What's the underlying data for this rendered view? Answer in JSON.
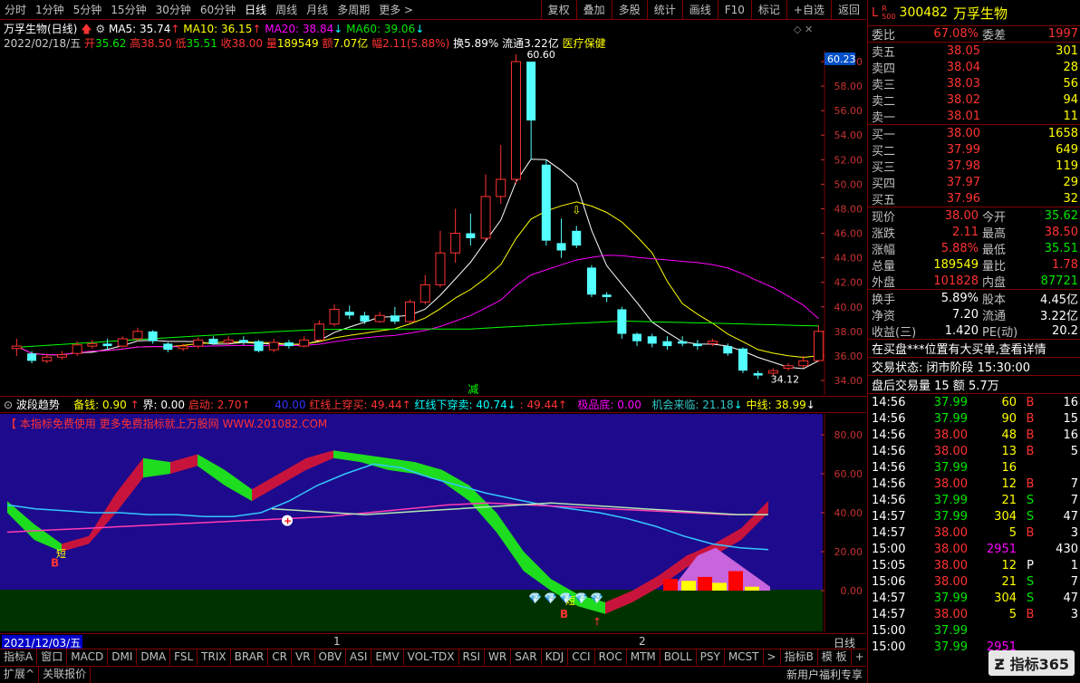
{
  "toolbar": {
    "periods": [
      "分时",
      "1分钟",
      "5分钟",
      "15分钟",
      "30分钟",
      "60分钟",
      "日线",
      "周线",
      "月线",
      "多周期",
      "更多 >"
    ],
    "active": "日线",
    "right": [
      "复权",
      "叠加",
      "多股",
      "统计",
      "画线",
      "F10",
      "标记",
      "+自选",
      "返回"
    ]
  },
  "stock": {
    "name": "万孚生物(日线)",
    "ma5": "MA5: 35.74",
    "ma10": "MA10: 36.15",
    "ma20": "MA20: 38.84",
    "ma60": "MA60: 39.06"
  },
  "kline_info": {
    "date": "2022/02/18/五",
    "open_l": "开",
    "open": "35.62",
    "high_l": "高",
    "high": "38.50",
    "low_l": "低",
    "low": "35.51",
    "close_l": "收",
    "close": "38.00",
    "vol_l": "量",
    "vol": "189549",
    "amt_l": "额",
    "amt": "7.07亿",
    "chg_l": "幅",
    "chg": "2.11(5.88%)",
    "turn": "换5.89%",
    "float": "流通3.22亿",
    "sector": "医疗保健"
  },
  "price_axis": [
    "60.00",
    "58.00",
    "56.00",
    "54.00",
    "52.00",
    "50.00",
    "48.00",
    "46.00",
    "44.00",
    "42.00",
    "40.00",
    "38.00",
    "36.00",
    "34.00"
  ],
  "price_tag": "60.23",
  "annotations": {
    "high": "60.60",
    "low": "34.12",
    "jian": "减"
  },
  "ind_header": {
    "name": "波段趋势",
    "a": "备钱: 0.90",
    "b": "界: 0.00",
    "c": "启动: 2.70",
    "d": "40.00",
    "e": "红线上穿买: 49.44",
    "f": "红线下穿卖: 40.74",
    "g": ": 49.44",
    "h": "极品底: 0.00",
    "i": "机会来临: 21.18",
    "j": "中线: 38.99"
  },
  "ind_notice": "【 本指标免费使用 更多免费指标就上万股网 WWW.201082.COM",
  "ind_axis": [
    "80.00",
    "60.00",
    "40.00",
    "20.00",
    "0.00"
  ],
  "ind_marks": {
    "b1": "B",
    "duan1": "短",
    "b2": "B",
    "duan2": "短"
  },
  "date_bar": {
    "date": "2021/12/03/五",
    "m1": "1",
    "m2": "2",
    "right": "日线"
  },
  "bottom_tabs": [
    "指标A",
    "窗口",
    "MACD",
    "DMI",
    "DMA",
    "FSL",
    "TRIX",
    "BRAR",
    "CR",
    "VR",
    "OBV",
    "ASI",
    "EMV",
    "VOL-TDX",
    "RSI",
    "WR",
    "SAR",
    "KDJ",
    "CCI",
    "ROC",
    "MTM",
    "BOLL",
    "PSY",
    "MCST",
    ">",
    "指标B",
    "模 板",
    "+",
    "-"
  ],
  "status": {
    "a": "扩展^",
    "b": "关联报价",
    "right": "新用户福利专享"
  },
  "quote": {
    "code": "300482",
    "name": "万孚生物",
    "weibi_l": "委比",
    "weibi": "67.08%",
    "weicha_l": "委差",
    "weicha": "1997",
    "sells": [
      [
        "卖五",
        "38.05",
        "301"
      ],
      [
        "卖四",
        "38.04",
        "28"
      ],
      [
        "卖三",
        "38.03",
        "56"
      ],
      [
        "卖二",
        "38.02",
        "94"
      ],
      [
        "卖一",
        "38.01",
        "11"
      ]
    ],
    "buys": [
      [
        "买一",
        "38.00",
        "1658"
      ],
      [
        "买二",
        "37.99",
        "649"
      ],
      [
        "买三",
        "37.98",
        "119"
      ],
      [
        "买四",
        "37.97",
        "29"
      ],
      [
        "买五",
        "37.96",
        "32"
      ]
    ],
    "stats": [
      [
        "现价",
        "38.00",
        "今开",
        "35.62"
      ],
      [
        "涨跌",
        "2.11",
        "最高",
        "38.50"
      ],
      [
        "涨幅",
        "5.88%",
        "最低",
        "35.51"
      ],
      [
        "总量",
        "189549",
        "量比",
        "1.78"
      ],
      [
        "外盘",
        "101828",
        "内盘",
        "87721"
      ]
    ],
    "stats2": [
      [
        "换手",
        "5.89%",
        "股本",
        "4.45亿"
      ],
      [
        "净资",
        "7.20",
        "流通",
        "3.22亿"
      ],
      [
        "收益(三)",
        "1.420",
        "PE(动)",
        "20.2"
      ]
    ],
    "notice": "在买盘***位置有大买单,查看详情",
    "trade_state": "交易状态: 闭市阶段 15:30:00",
    "after": "盘后交易量 15 额 5.7万",
    "ticks": [
      [
        "14:56",
        "37.99",
        "60",
        "B",
        "16"
      ],
      [
        "14:56",
        "37.99",
        "90",
        "B",
        "15"
      ],
      [
        "14:56",
        "38.00",
        "48",
        "B",
        "16"
      ],
      [
        "14:56",
        "38.00",
        "13",
        "B",
        "5"
      ],
      [
        "14:56",
        "37.99",
        "16",
        "",
        ""
      ],
      [
        "14:56",
        "38.00",
        "12",
        "B",
        "7"
      ],
      [
        "14:56",
        "37.99",
        "21",
        "S",
        "7"
      ],
      [
        "14:57",
        "37.99",
        "304",
        "S",
        "47"
      ],
      [
        "14:57",
        "38.00",
        "5",
        "B",
        "3"
      ],
      [
        "15:00",
        "38.00",
        "2951",
        "",
        "430"
      ],
      [
        "15:05",
        "38.00",
        "12",
        "P",
        "1"
      ],
      [
        "15:06",
        "38.00",
        "21",
        "S",
        "7"
      ],
      [
        "14:57",
        "37.99",
        "304",
        "S",
        "47"
      ],
      [
        "14:57",
        "38.00",
        "5",
        "B",
        "3"
      ],
      [
        "15:00",
        "37.99",
        "",
        "",
        ""
      ],
      [
        "15:00",
        "37.99",
        "2951",
        "",
        ""
      ]
    ],
    "logo": "指标365"
  },
  "colors": {
    "up": "#ff3232",
    "down": "#54ffff",
    "ma5": "#ffffff",
    "ma10": "#ffff00",
    "ma20": "#ff00ff",
    "ma60": "#00ff00",
    "ind_bg": "#1e0a8c",
    "ind_floor": "#003200"
  }
}
